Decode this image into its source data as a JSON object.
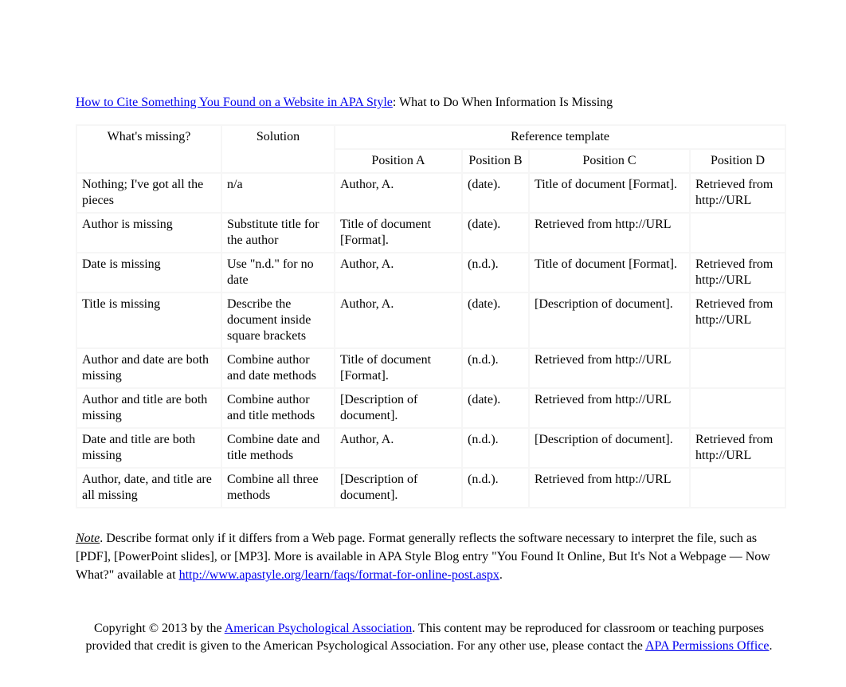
{
  "title": {
    "link_text": "How to Cite Something You Found on a Website in APA Style",
    "suffix": ": What to Do When Information Is Missing"
  },
  "table": {
    "headers": {
      "col0": "What's missing?",
      "col1": "Solution",
      "span_label": "Reference template",
      "posA": "Position A",
      "posB": "Position B",
      "posC": "Position C",
      "posD": "Position D"
    },
    "rows": [
      {
        "missing": "Nothing; I've got all the pieces",
        "solution": "n/a",
        "a": "Author, A.",
        "b": "(date).",
        "c": "Title of document [Format].",
        "d": "Retrieved from http://URL"
      },
      {
        "missing": "Author is missing",
        "solution": "Substitute title for the author",
        "a": "Title of document [Format].",
        "b": "(date).",
        "c": "Retrieved from http://URL",
        "d": ""
      },
      {
        "missing": "Date is missing",
        "solution": "Use \"n.d.\" for no date",
        "a": "Author, A.",
        "b": "(n.d.).",
        "c": "Title of document [Format].",
        "d": "Retrieved from http://URL"
      },
      {
        "missing": "Title is missing",
        "solution": "Describe the document inside square brackets",
        "a": "Author, A.",
        "b": "(date).",
        "c": "[Description of document].",
        "d": "Retrieved from http://URL"
      },
      {
        "missing": "Author and date are both missing",
        "solution": "Combine author and date methods",
        "a": "Title of document [Format].",
        "b": "(n.d.).",
        "c": "Retrieved from http://URL",
        "d": ""
      },
      {
        "missing": "Author and title are both missing",
        "solution": "Combine author and title methods",
        "a": "[Description of document].",
        "b": "(date).",
        "c": "Retrieved from http://URL",
        "d": ""
      },
      {
        "missing": "Date and title are both missing",
        "solution": "Combine date and title methods",
        "a": "Author, A.",
        "b": "(n.d.).",
        "c": "[Description of document].",
        "d": "Retrieved from http://URL"
      },
      {
        "missing": "Author, date, and title are all missing",
        "solution": "Combine all three methods",
        "a": "[Description of document].",
        "b": "(n.d.).",
        "c": "Retrieved from http://URL",
        "d": ""
      }
    ]
  },
  "note": {
    "label": "Note",
    "body_1": ". Describe format only if it differs from a Web page. Format generally reflects the software necessary to interpret the file, such as [PDF], [PowerPoint slides], or [MP3]. More is available in APA Style Blog entry \"You Found It Online, But It's Not a Webpage — Now What?\" available at ",
    "link": "http://www.apastyle.org/learn/faqs/format-for-online-post.aspx",
    "body_2": "."
  },
  "copyright": {
    "pre": "Copyright © 2013 by the ",
    "link1_text": "American Psychological Association",
    "mid": ". This content may be reproduced for classroom or teaching purposes provided that credit is given to the American Psychological Association. For any other use, please contact the ",
    "link2_text": "APA Permissions Office",
    "post": "."
  }
}
